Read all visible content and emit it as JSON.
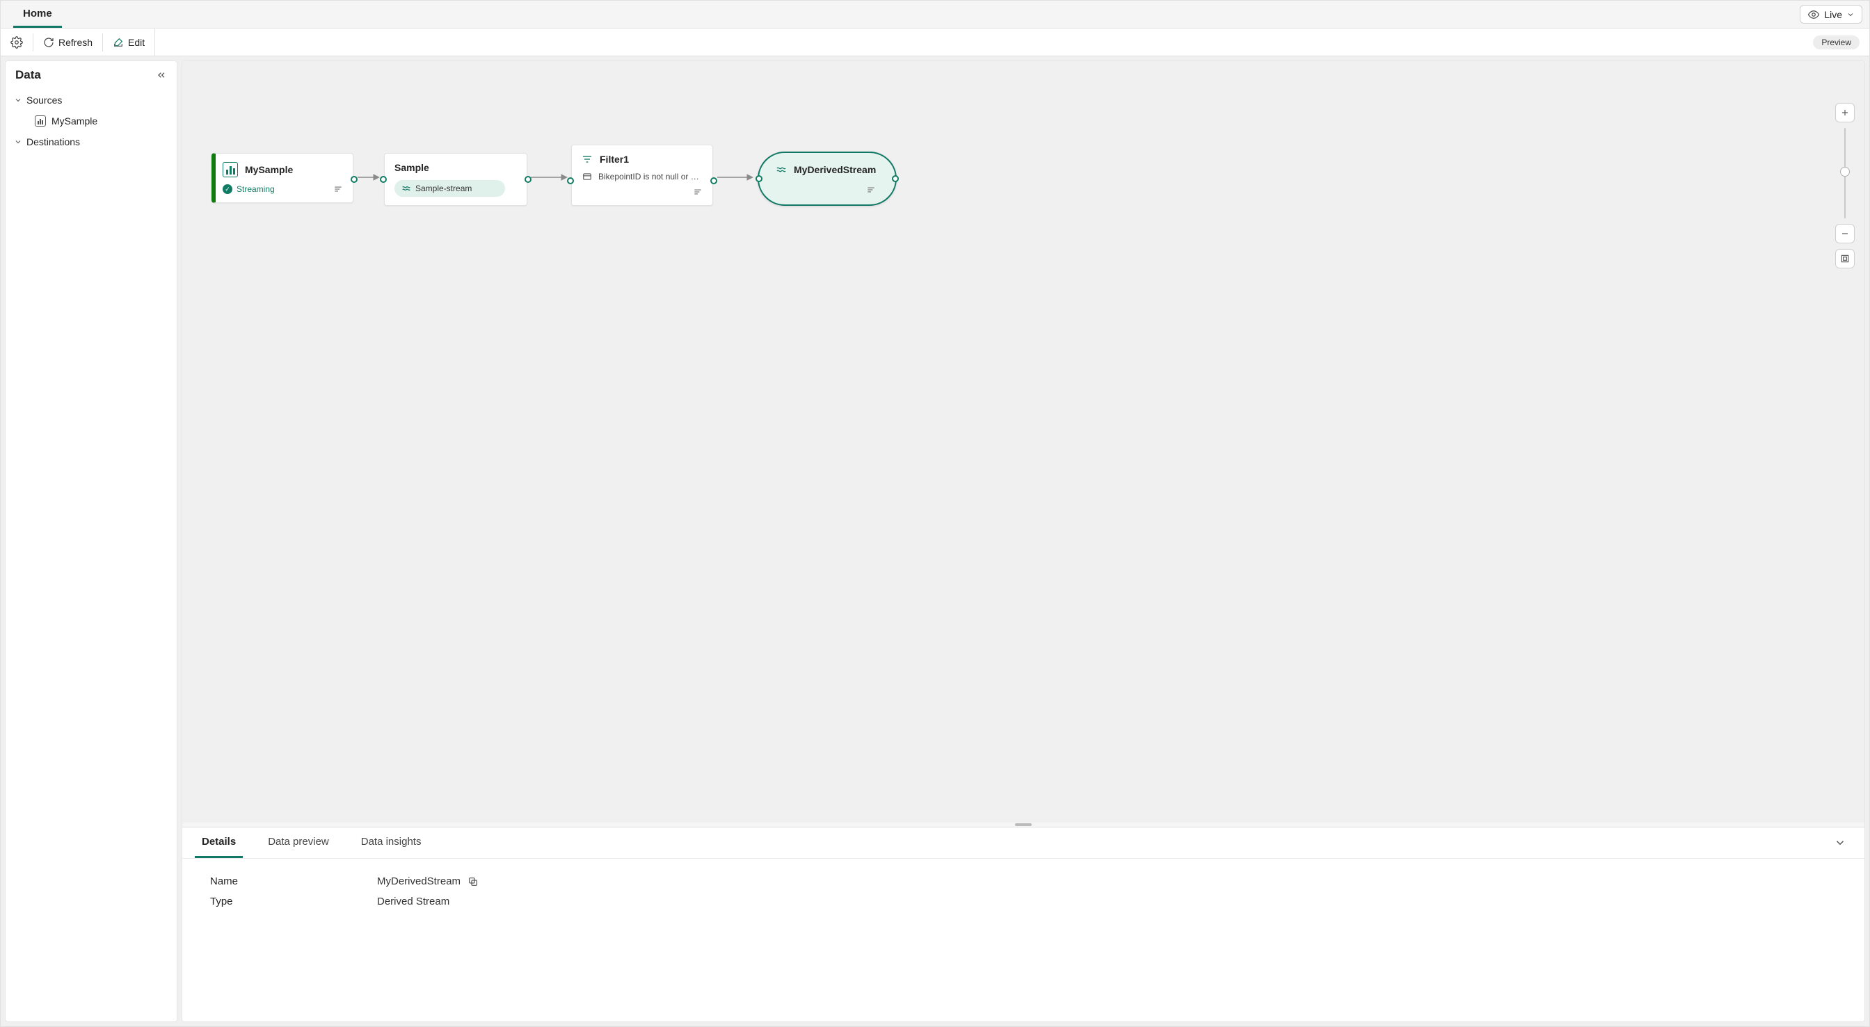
{
  "tabs": {
    "home": "Home"
  },
  "header": {
    "view_mode": "Live",
    "refresh": "Refresh",
    "edit": "Edit",
    "preview_badge": "Preview"
  },
  "sidebar": {
    "title": "Data",
    "groups": {
      "sources": {
        "label": "Sources",
        "items": [
          {
            "label": "MySample"
          }
        ]
      },
      "destinations": {
        "label": "Destinations"
      }
    }
  },
  "canvas": {
    "nodes": {
      "source": {
        "title": "MySample",
        "status": "Streaming"
      },
      "sample": {
        "title": "Sample",
        "chip": "Sample-stream"
      },
      "filter": {
        "title": "Filter1",
        "condition": "BikepointID is not null or e…"
      },
      "derived": {
        "title": "MyDerivedStream"
      }
    }
  },
  "bottom": {
    "tabs": {
      "details": "Details",
      "preview": "Data preview",
      "insights": "Data insights"
    },
    "details": {
      "name_label": "Name",
      "name_value": "MyDerivedStream",
      "type_label": "Type",
      "type_value": "Derived Stream"
    }
  }
}
